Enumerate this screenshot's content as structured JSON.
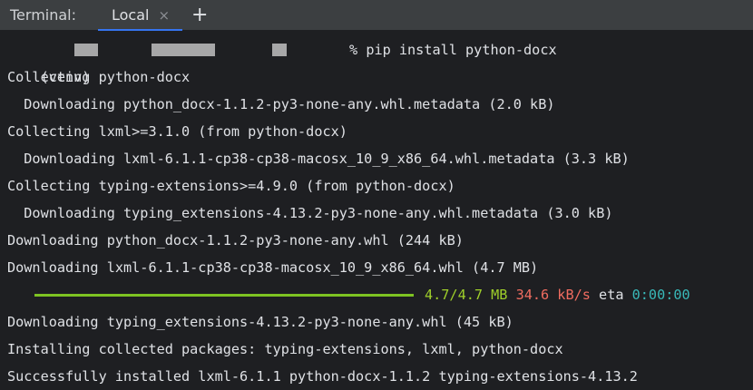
{
  "tabbar": {
    "title": "Terminal:",
    "tab_label": "Local",
    "close_glyph": "×",
    "add_glyph": "+"
  },
  "prompt": {
    "venv": "(venv)",
    "symbol": "%",
    "command": "pip install python-docx"
  },
  "output": [
    "Collecting python-docx",
    "  Downloading python_docx-1.1.2-py3-none-any.whl.metadata (2.0 kB)",
    "Collecting lxml>=3.1.0 (from python-docx)",
    "  Downloading lxml-6.1.1-cp38-cp38-macosx_10_9_x86_64.whl.metadata (3.3 kB)",
    "Collecting typing-extensions>=4.9.0 (from python-docx)",
    "  Downloading typing_extensions-4.13.2-py3-none-any.whl.metadata (3.0 kB)",
    "Downloading python_docx-1.1.2-py3-none-any.whl (244 kB)",
    "Downloading lxml-6.1.1-cp38-cp38-macosx_10_9_x86_64.whl (4.7 MB)"
  ],
  "progress": {
    "fraction": 1.0,
    "size": "4.7/4.7 MB",
    "speed": "34.6 kB/s",
    "eta_label": "eta",
    "eta": "0:00:00"
  },
  "output_after": [
    "Downloading typing_extensions-4.13.2-py3-none-any.whl (45 kB)",
    "Installing collected packages: typing-extensions, lxml, python-docx",
    "Successfully installed lxml-6.1.1 python-docx-1.1.2 typing-extensions-4.13.2"
  ],
  "colors": {
    "progress_bar": "#7ec322",
    "size_text": "#9fcf2a",
    "speed_text": "#f06c60",
    "eta_value": "#39b8b8",
    "tab_accent": "#3574f0"
  }
}
